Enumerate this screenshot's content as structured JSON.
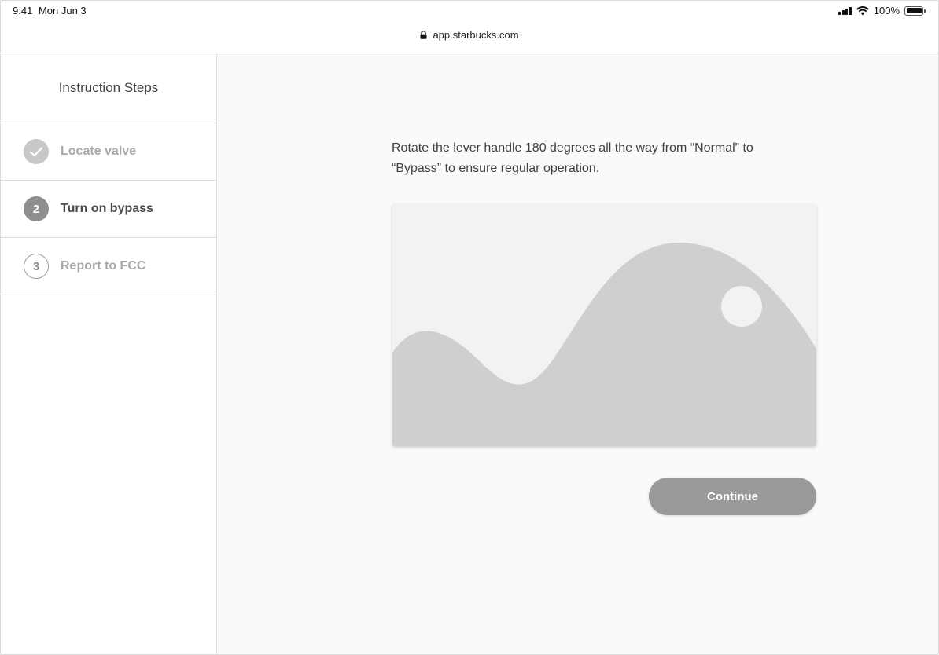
{
  "status_bar": {
    "time": "9:41",
    "date": "Mon Jun 3",
    "battery": "100%"
  },
  "browser": {
    "url": "app.starbucks.com"
  },
  "sidebar": {
    "title": "Instruction Steps",
    "steps": [
      {
        "number": "1",
        "label": "Locate valve",
        "state": "completed",
        "icon": "check-icon"
      },
      {
        "number": "2",
        "label": "Turn on bypass",
        "state": "active"
      },
      {
        "number": "3",
        "label": "Report to FCC",
        "state": "pending"
      }
    ]
  },
  "main": {
    "instruction": "Rotate the lever handle 180 degrees all the way from “Normal” to “Bypass” to ensure regular operation.",
    "image_icon": "image-placeholder-icon",
    "continue_label": "Continue"
  },
  "colors": {
    "placeholder_fill": "#cfcfcf",
    "button": "#9a9a9a",
    "sidebar_border": "#dcdcdc"
  }
}
